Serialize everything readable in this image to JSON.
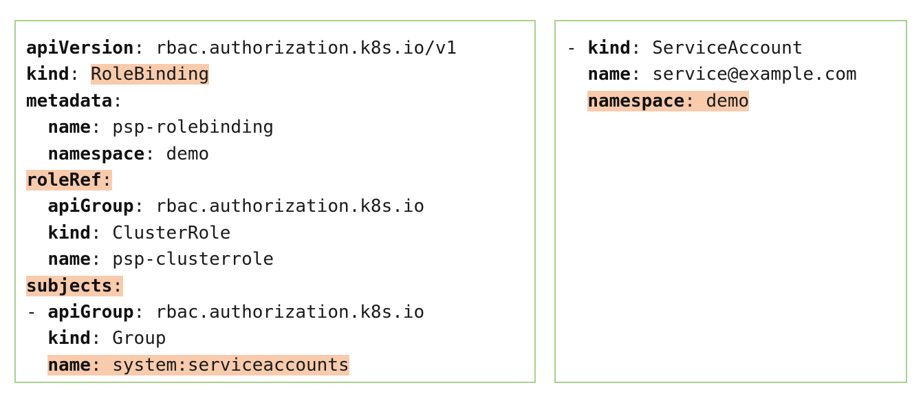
{
  "left_panel": {
    "lines": [
      {
        "indent": "",
        "key": "apiVersion",
        "sep": ": ",
        "value": "rbac.authorization.k8s.io/v1",
        "highlight": "none"
      },
      {
        "indent": "",
        "key": "kind",
        "sep": ": ",
        "value": "RoleBinding",
        "highlight": "value"
      },
      {
        "indent": "",
        "key": "metadata",
        "sep": ":",
        "value": "",
        "highlight": "none"
      },
      {
        "indent": "  ",
        "key": "name",
        "sep": ": ",
        "value": "psp-rolebinding",
        "highlight": "none"
      },
      {
        "indent": "  ",
        "key": "namespace",
        "sep": ": ",
        "value": "demo",
        "highlight": "none"
      },
      {
        "indent": "",
        "key": "roleRef",
        "sep": ":",
        "value": "",
        "highlight": "full"
      },
      {
        "indent": "  ",
        "key": "apiGroup",
        "sep": ": ",
        "value": "rbac.authorization.k8s.io",
        "highlight": "none"
      },
      {
        "indent": "  ",
        "key": "kind",
        "sep": ": ",
        "value": "ClusterRole",
        "highlight": "none"
      },
      {
        "indent": "  ",
        "key": "name",
        "sep": ": ",
        "value": "psp-clusterrole",
        "highlight": "none"
      },
      {
        "indent": "",
        "key": "subjects",
        "sep": ":",
        "value": "",
        "highlight": "full"
      },
      {
        "indent": "- ",
        "key": "apiGroup",
        "sep": ": ",
        "value": "rbac.authorization.k8s.io",
        "highlight": "none"
      },
      {
        "indent": "  ",
        "key": "kind",
        "sep": ": ",
        "value": "Group",
        "highlight": "none"
      },
      {
        "indent": "  ",
        "key": "name",
        "sep": ": ",
        "value": "system:serviceaccounts",
        "highlight": "full"
      }
    ]
  },
  "right_panel": {
    "lines": [
      {
        "indent": "- ",
        "key": "kind",
        "sep": ": ",
        "value": "ServiceAccount",
        "highlight": "none"
      },
      {
        "indent": "  ",
        "key": "name",
        "sep": ": ",
        "value": "service@example.com",
        "highlight": "none"
      },
      {
        "indent": "  ",
        "key": "namespace",
        "sep": ": ",
        "value": "demo",
        "highlight": "full"
      }
    ]
  },
  "colors": {
    "border": "#a9d18e",
    "highlight": "#f8cbad",
    "text": "#1a1a1a"
  }
}
